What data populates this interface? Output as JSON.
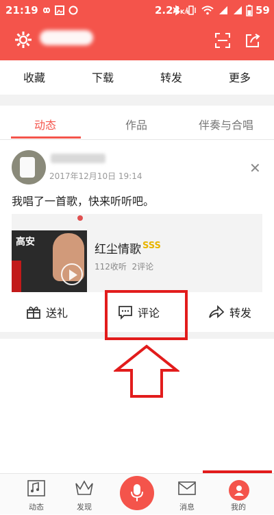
{
  "status_bar": {
    "time": "21:19",
    "speed": "2.24",
    "speed_unit": "K/s",
    "battery": "59"
  },
  "header": {
    "settings_icon": "gear-icon",
    "scan_icon": "scan-icon",
    "share_icon": "share-icon"
  },
  "quick_menu": [
    "收藏",
    "下载",
    "转发",
    "更多"
  ],
  "tabs": [
    {
      "label": "动态",
      "active": true
    },
    {
      "label": "作品",
      "active": false
    },
    {
      "label": "伴奏与合唱",
      "active": false
    }
  ],
  "post": {
    "date": "2017年12月10日 19:14",
    "text": "我唱了一首歌，快来听听吧。",
    "close_icon": "close-icon",
    "song": {
      "title": "红尘情歌",
      "badge": "SSS",
      "plays": "112收听",
      "comments": "2评论",
      "cover_text": "高安"
    },
    "actions": [
      {
        "label": "送礼",
        "icon": "gift-icon"
      },
      {
        "label": "评论",
        "icon": "comment-icon"
      },
      {
        "label": "转发",
        "icon": "forward-icon"
      }
    ]
  },
  "bottom_nav": [
    {
      "label": "动态",
      "icon": "feed-icon"
    },
    {
      "label": "发现",
      "icon": "crown-icon"
    },
    {
      "label": "",
      "icon": "microphone-icon"
    },
    {
      "label": "消息",
      "icon": "message-icon"
    },
    {
      "label": "我的",
      "icon": "profile-icon"
    }
  ],
  "colors": {
    "accent": "#f4544b",
    "annotation": "#e21c1c"
  }
}
